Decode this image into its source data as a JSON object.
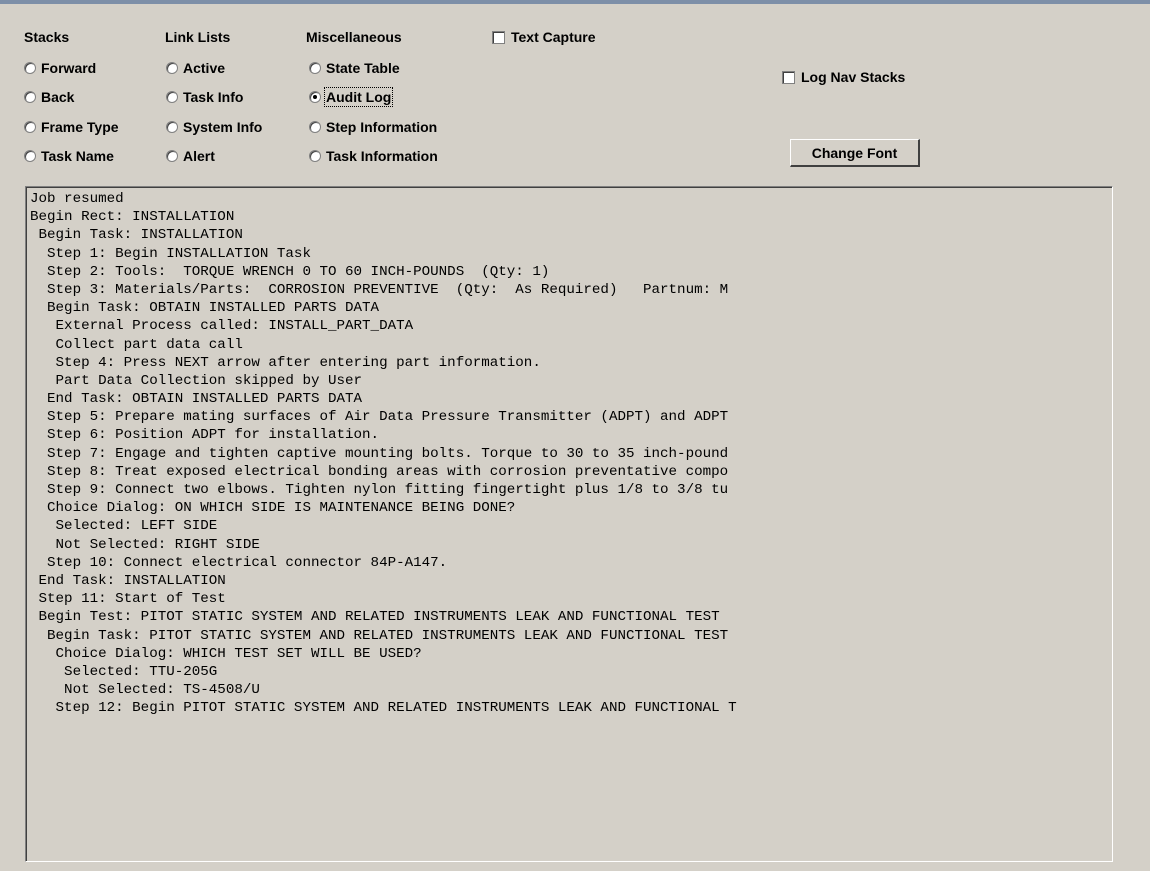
{
  "headers": {
    "stacks": "Stacks",
    "link_lists": "Link Lists",
    "misc": "Miscellaneous"
  },
  "stacks": [
    "Forward",
    "Back",
    "Frame Type",
    "Task Name"
  ],
  "link_lists": [
    "Active",
    "Task Info",
    "System Info",
    "Alert"
  ],
  "misc": [
    "State Table",
    "Audit Log",
    "Step Information",
    "Task Information"
  ],
  "selected_option": "Audit Log",
  "text_capture_label": "Text Capture",
  "text_capture_checked": false,
  "log_nav_label": "Log Nav Stacks",
  "log_nav_checked": false,
  "change_font_label": "Change Font",
  "log_lines": [
    "Job resumed",
    "Begin Rect: INSTALLATION",
    " Begin Task: INSTALLATION",
    "  Step 1: Begin INSTALLATION Task",
    "  Step 2: Tools:  TORQUE WRENCH 0 TO 60 INCH-POUNDS  (Qty: 1)",
    "  Step 3: Materials/Parts:  CORROSION PREVENTIVE  (Qty:  As Required)   Partnum: M",
    "  Begin Task: OBTAIN INSTALLED PARTS DATA",
    "   External Process called: INSTALL_PART_DATA",
    "   Collect part data call",
    "   Step 4: Press NEXT arrow after entering part information.",
    "   Part Data Collection skipped by User",
    "  End Task: OBTAIN INSTALLED PARTS DATA",
    "  Step 5: Prepare mating surfaces of Air Data Pressure Transmitter (ADPT) and ADPT",
    "  Step 6: Position ADPT for installation.",
    "  Step 7: Engage and tighten captive mounting bolts. Torque to 30 to 35 inch-pound",
    "  Step 8: Treat exposed electrical bonding areas with corrosion preventative compo",
    "  Step 9: Connect two elbows. Tighten nylon fitting fingertight plus 1/8 to 3/8 tu",
    "  Choice Dialog: ON WHICH SIDE IS MAINTENANCE BEING DONE?",
    "   Selected: LEFT SIDE",
    "   Not Selected: RIGHT SIDE",
    "  Step 10: Connect electrical connector 84P-A147.",
    " End Task: INSTALLATION",
    " Step 11: Start of Test",
    " Begin Test: PITOT STATIC SYSTEM AND RELATED INSTRUMENTS LEAK AND FUNCTIONAL TEST",
    "  Begin Task: PITOT STATIC SYSTEM AND RELATED INSTRUMENTS LEAK AND FUNCTIONAL TEST",
    "   Choice Dialog: WHICH TEST SET WILL BE USED?",
    "    Selected: TTU-205G",
    "    Not Selected: TS-4508/U",
    "   Step 12: Begin PITOT STATIC SYSTEM AND RELATED INSTRUMENTS LEAK AND FUNCTIONAL T"
  ]
}
